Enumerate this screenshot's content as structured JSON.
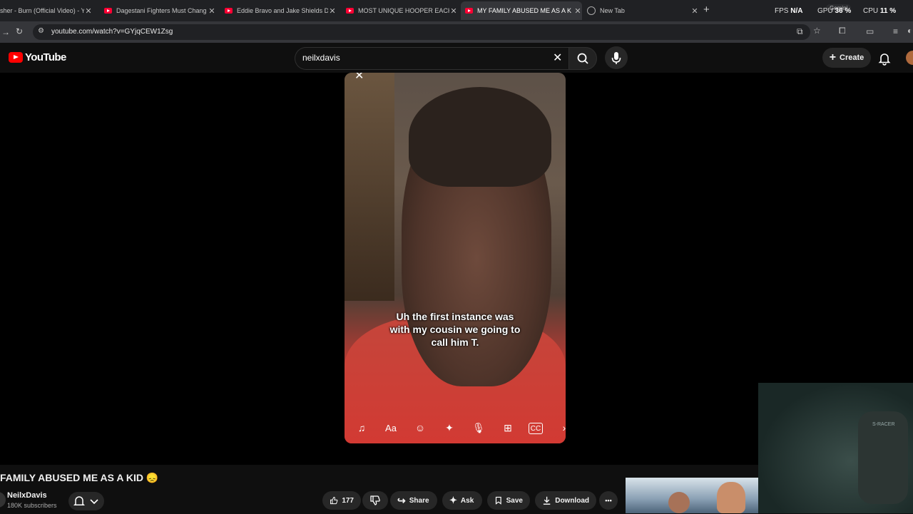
{
  "browser": {
    "tabs": [
      {
        "title": "sher - Burn (Official Video) - Y",
        "active": false
      },
      {
        "title": "Dagestani Fighters Must Chang",
        "active": false
      },
      {
        "title": "Eddie Bravo and Jake Shields D",
        "active": false
      },
      {
        "title": "MOST UNIQUE HOOPER EACH",
        "active": false
      },
      {
        "title": "MY FAMILY ABUSED ME AS A K",
        "active": true
      },
      {
        "title": "New Tab",
        "active": false
      }
    ],
    "new_tab_label": "+",
    "gemini_label": "Gemini",
    "perf": {
      "fps_label": "FPS",
      "fps_value": "N/A",
      "gpu_label": "GPU",
      "gpu_value": "36 %",
      "cpu_label": "CPU",
      "cpu_value": "11 %"
    },
    "url": "youtube.com/watch?v=GYjqCEW1Zsg"
  },
  "youtube": {
    "logo_text": "YouTube",
    "search_query": "neilxdavis",
    "create_label": "Create"
  },
  "video": {
    "caption_lines": [
      "Uh the first instance was",
      "with my cousin we going to",
      "call him T."
    ],
    "title": "FAMILY ABUSED ME AS A KID 😞",
    "channel": "NeilxDavis",
    "subscribers": "180K subscribers",
    "likes": "177",
    "share_label": "Share",
    "ask_label": "Ask",
    "save_label": "Save",
    "download_label": "Download",
    "more_label": "•••"
  },
  "colors": {
    "accent": "#ff0000",
    "background": "#0f0f0f",
    "shirt": "#d23a33"
  }
}
